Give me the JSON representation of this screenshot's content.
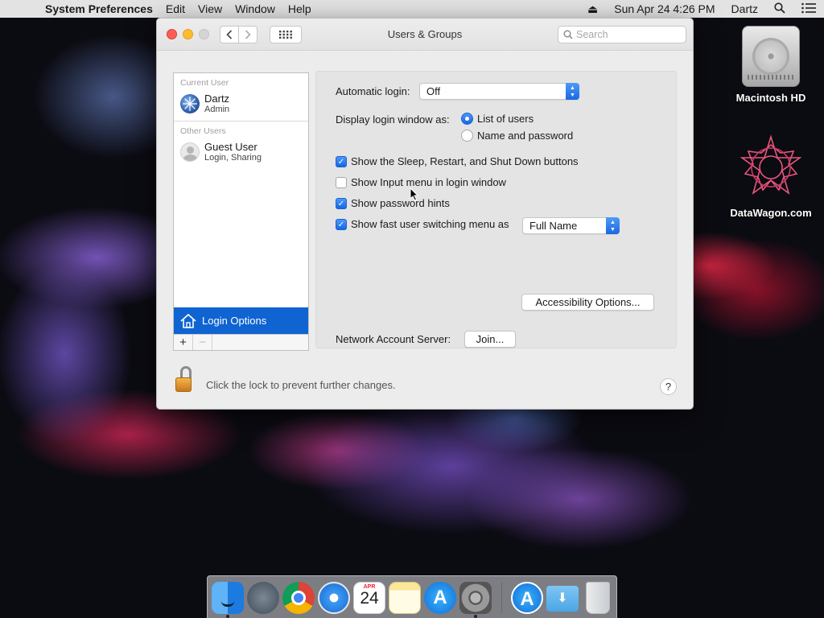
{
  "menubar": {
    "app_name": "System Preferences",
    "menus": [
      "Edit",
      "View",
      "Window",
      "Help"
    ],
    "clock": "Sun Apr 24  4:26 PM",
    "user": "Dartz"
  },
  "window": {
    "title": "Users & Groups",
    "search_placeholder": "Search"
  },
  "users": {
    "current_label": "Current User",
    "current": {
      "name": "Dartz",
      "role": "Admin"
    },
    "other_label": "Other Users",
    "others": [
      {
        "name": "Guest User",
        "role": "Login, Sharing"
      }
    ],
    "selected_item": "Login Options"
  },
  "login_options": {
    "automatic_login_label": "Automatic login:",
    "automatic_login_value": "Off",
    "display_label": "Display login window as:",
    "display_options": [
      "List of users",
      "Name and password"
    ],
    "display_selected": 0,
    "checkboxes": [
      {
        "label": "Show the Sleep, Restart, and Shut Down buttons",
        "checked": true
      },
      {
        "label": "Show Input menu in login window",
        "checked": false
      },
      {
        "label": "Show password hints",
        "checked": true
      },
      {
        "label": "Show fast user switching menu as",
        "checked": true
      }
    ],
    "fast_switch_value": "Full Name",
    "accessibility_button": "Accessibility Options...",
    "network_label": "Network Account Server:",
    "join_button": "Join..."
  },
  "footer": {
    "lock_text": "Click the lock to prevent further changes.",
    "help": "?"
  },
  "desktop": {
    "icons": [
      "Macintosh HD",
      "DataWagon.com"
    ]
  },
  "dock": {
    "calendar_month": "APR",
    "calendar_day": "24"
  },
  "colors": {
    "accent": "#0f64d2",
    "close": "#fd5f57",
    "minimize": "#febb2e"
  }
}
